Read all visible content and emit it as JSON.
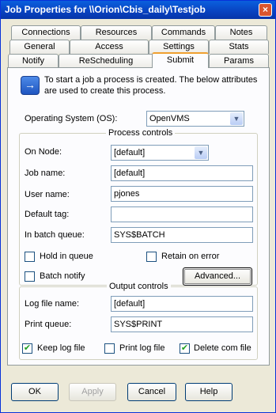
{
  "window": {
    "title": "Job Properties for \\\\Orion\\Cbis_daily\\Testjob",
    "close": "×"
  },
  "tabs": {
    "row1": [
      "Connections",
      "Resources",
      "Commands",
      "Notes"
    ],
    "row2": [
      "General",
      "Access",
      "Settings",
      "Stats"
    ],
    "row3": [
      "Notify",
      "ReScheduling",
      "Submit",
      "Params"
    ]
  },
  "info": {
    "icon": "→",
    "line1": "To start a job a process is created.  The below attributes",
    "line2": "are used to create this process."
  },
  "os": {
    "label": "Operating System (OS):",
    "value": "OpenVMS"
  },
  "process_controls": {
    "title": "Process controls",
    "on_node_label": "On Node:",
    "on_node_value": "[default]",
    "job_name_label": "Job name:",
    "job_name_value": "[default]",
    "user_name_label": "User name:",
    "user_name_value": "pjones",
    "default_tag_label": "Default tag:",
    "default_tag_value": "",
    "batch_queue_label": "In batch queue:",
    "batch_queue_value": "SYS$BATCH",
    "hold_label": "Hold in queue",
    "hold_checked": false,
    "retain_label": "Retain on error",
    "retain_checked": false,
    "batch_notify_label": "Batch notify",
    "batch_notify_checked": false,
    "advanced_label": "Advanced..."
  },
  "output_controls": {
    "title": "Output controls",
    "log_file_label": "Log file name:",
    "log_file_value": "[default]",
    "print_queue_label": "Print queue:",
    "print_queue_value": "SYS$PRINT",
    "keep_log_label": "Keep log file",
    "keep_log_checked": true,
    "print_log_label": "Print log file",
    "print_log_checked": false,
    "delete_com_label": "Delete com file",
    "delete_com_checked": true
  },
  "buttons": {
    "ok": "OK",
    "apply": "Apply",
    "cancel": "Cancel",
    "help": "Help"
  }
}
